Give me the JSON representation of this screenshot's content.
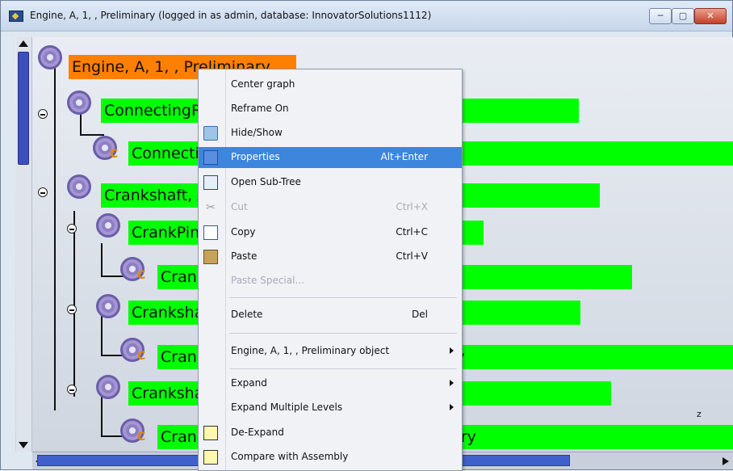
{
  "window": {
    "title": "Engine, A, 1, , Preliminary (logged in as admin, database: InnovatorSolutions1112)",
    "buttons": {
      "minimize": "─",
      "maximize": "▢",
      "close": "✕"
    }
  },
  "tree": {
    "nodes": [
      {
        "label": "Engine, A, 1, , Preliminary",
        "state": "root"
      },
      {
        "label": "ConnectingRod, A, 1, , Preliminary",
        "state": "part"
      },
      {
        "label": "ConnectingRodModel, A, 1, , Preliminary",
        "state": "component"
      },
      {
        "label": "Crankshaft, A, 1, , Preliminary",
        "state": "part"
      },
      {
        "label": "CrankPin, A, 1, , Preliminary",
        "state": "part"
      },
      {
        "label": "CrankPinModel, A, 1, , Preliminary",
        "state": "component"
      },
      {
        "label": "CrankshaftLeft, A, 1, , Preliminary",
        "state": "part"
      },
      {
        "label": "CrankshaftLeftModel, A, 1, , Preliminary",
        "state": "component"
      },
      {
        "label": "CrankshaftRight, A, 1, , Preliminary",
        "state": "part"
      },
      {
        "label": "CrankshaftRightModel, A, 1, , Preliminary",
        "state": "component"
      }
    ],
    "stray_mark": "z"
  },
  "context_menu": {
    "items": [
      {
        "label": "Center graph",
        "shortcut": "",
        "icon": "",
        "enabled": true
      },
      {
        "label": "Reframe On",
        "shortcut": "",
        "icon": "",
        "enabled": true
      },
      {
        "label": "Hide/Show",
        "shortcut": "",
        "icon": "hide-show-icon",
        "enabled": true
      },
      {
        "label": "Properties",
        "shortcut": "Alt+Enter",
        "icon": "properties-icon",
        "enabled": true,
        "highlighted": true
      },
      {
        "label": "Open Sub-Tree",
        "shortcut": "",
        "icon": "sub-tree-icon",
        "enabled": true
      },
      {
        "label": "Cut",
        "shortcut": "Ctrl+X",
        "icon": "scissors-icon",
        "enabled": false
      },
      {
        "label": "Copy",
        "shortcut": "Ctrl+C",
        "icon": "copy-icon",
        "enabled": true
      },
      {
        "label": "Paste",
        "shortcut": "Ctrl+V",
        "icon": "paste-icon",
        "enabled": true
      },
      {
        "label": "Paste Special...",
        "shortcut": "",
        "icon": "",
        "enabled": false
      },
      {
        "label": "Delete",
        "shortcut": "Del",
        "icon": "",
        "enabled": true
      },
      {
        "label": "Engine, A, 1, , Preliminary object",
        "shortcut": "",
        "icon": "",
        "enabled": true,
        "submenu": true
      },
      {
        "label": "Expand",
        "shortcut": "",
        "icon": "",
        "enabled": true,
        "submenu": true
      },
      {
        "label": "Expand Multiple Levels",
        "shortcut": "",
        "icon": "",
        "enabled": true,
        "submenu": true
      },
      {
        "label": "De-Expand",
        "shortcut": "",
        "icon": "de-expand-icon",
        "enabled": true
      },
      {
        "label": "Compare with Assembly",
        "shortcut": "",
        "icon": "compare-assembly-icon",
        "enabled": true
      }
    ]
  },
  "colors": {
    "root_node": "#ff7f00",
    "part_node": "#00ff00",
    "menu_highlight": "#3d86de"
  }
}
